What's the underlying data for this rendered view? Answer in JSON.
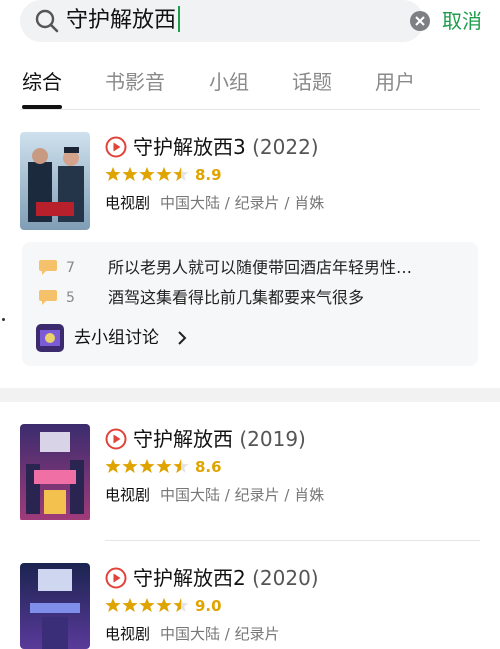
{
  "search": {
    "query": "守护解放西",
    "cancel_label": "取消"
  },
  "tabs": [
    {
      "label": "综合",
      "active": true
    },
    {
      "label": "书影音",
      "active": false
    },
    {
      "label": "小组",
      "active": false
    },
    {
      "label": "话题",
      "active": false
    },
    {
      "label": "用户",
      "active": false
    }
  ],
  "results": [
    {
      "title": "守护解放西3",
      "year": "(2022)",
      "rating": 8.9,
      "rating_stars": 4.5,
      "tag": "电视剧",
      "info": "中国大陆 / 纪录片 / 肖姝"
    },
    {
      "title": "守护解放西",
      "year": "(2019)",
      "rating": 8.6,
      "rating_stars": 4.5,
      "tag": "电视剧",
      "info": "中国大陆 / 纪录片 / 肖姝"
    },
    {
      "title": "守护解放西2",
      "year": "(2020)",
      "rating": 9.0,
      "rating_stars": 4.5,
      "tag": "电视剧",
      "info": "中国大陆 / 纪录片"
    }
  ],
  "discussion": {
    "comments": [
      {
        "count": "7",
        "text": "所以老男人就可以随便带回酒店年轻男性…"
      },
      {
        "count": "5",
        "text": "酒驾这集看得比前几集都要来气很多"
      }
    ],
    "group_link_label": "去小组讨论"
  },
  "colors": {
    "accent_green": "#1f9d4c",
    "rating_orange": "#e0a400",
    "play_red": "#e0433a"
  },
  "icons": {
    "search": "search-icon",
    "clear": "clear-icon",
    "play": "play-icon",
    "star": "star-icon",
    "comment": "comment-bubble-icon",
    "chevron": "chevron-right-icon"
  }
}
